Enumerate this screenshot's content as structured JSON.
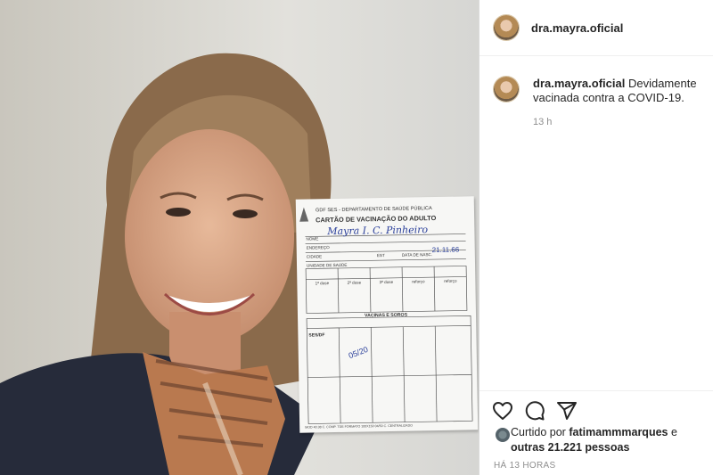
{
  "post": {
    "username": "dra.mayra.oficial",
    "caption": "Devidamente vacinada contra a COVID-19.",
    "time": "13 h",
    "likes_prefix": "Curtido por",
    "likes_user": "fatimammmarques",
    "likes_mid": "e",
    "likes_count": "outras 21.221 pessoas",
    "posted_ago": "HÁ 13 HORAS"
  },
  "card": {
    "header_line": "GDF SES - DEPARTAMENTO DE SAÚDE PÚBLICA",
    "title": "CARTÃO DE VACINAÇÃO DO ADULTO",
    "nome_label": "NOME",
    "nome_value": "Mayra I. C. Pinheiro",
    "endereco_label": "ENDEREÇO",
    "cidade_label": "CIDADE",
    "est_label": "EST",
    "data_label": "DATA DE NASC.",
    "data_value": "21.11.66",
    "unidade_label": "UNIDADE DE SAÚDE",
    "doses": [
      "1ª dose",
      "2ª dose",
      "3ª dose",
      "reforço",
      "reforço"
    ],
    "vacinas_title": "VACINAS E SOROS",
    "ses_label": "SES/DF",
    "ses_date": "05/20",
    "footer": "MOD 40.38   C. COMP. TDE   FORMATO 100X150   04/50   C. CENTRALIZADO"
  },
  "icons": {
    "like": "heart-icon",
    "comment": "comment-icon",
    "share": "share-icon"
  },
  "colors": {
    "username": "#262626",
    "meta": "#8e8e8e",
    "ink": "#2a3f9a"
  }
}
